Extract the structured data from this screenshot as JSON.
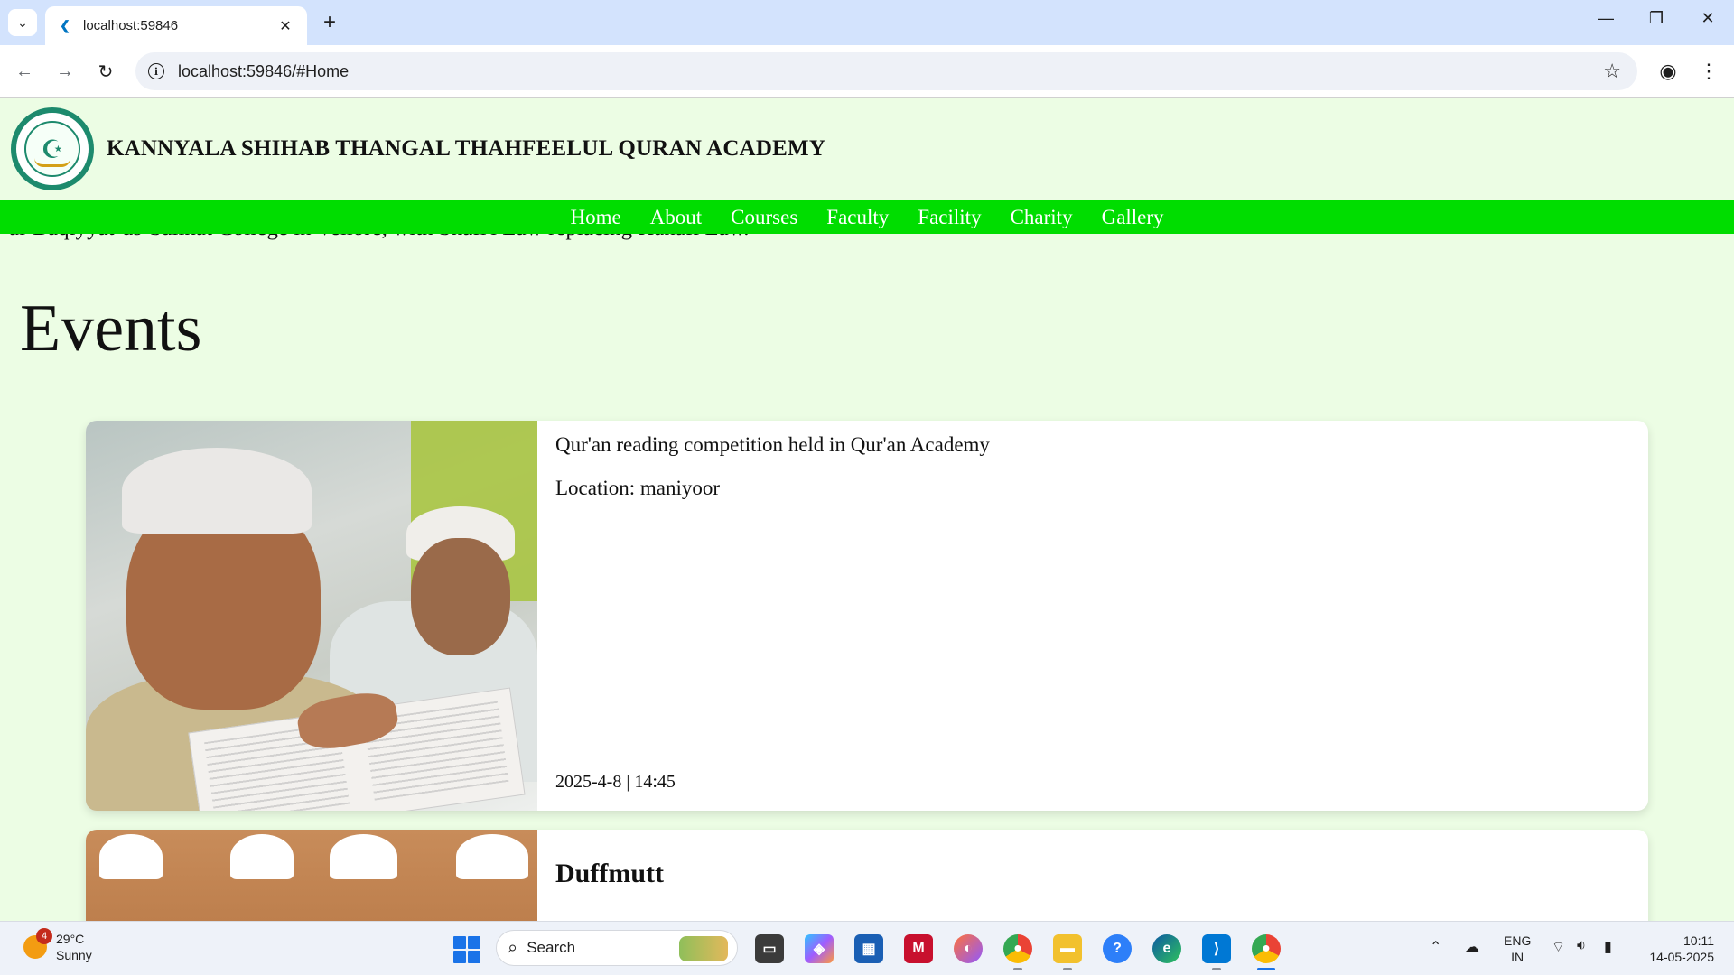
{
  "browser": {
    "tab_title": "localhost:59846",
    "url": "localhost:59846/#Home"
  },
  "site": {
    "title": "KANNYALA SHIHAB THANGAL THAHFEELUL QURAN ACADEMY",
    "nav": [
      "Home",
      "About",
      "Courses",
      "Faculty",
      "Facility",
      "Charity",
      "Gallery"
    ],
    "scrolled_text": "al-Baqiyyat-us-Salihat College in Vellore, with Shafi'i Law replacing Hanafi Law."
  },
  "events": {
    "heading": "Events",
    "items": [
      {
        "title": "Qur'an reading competition held in Qur'an Academy",
        "location": "Location: maniyoor",
        "datetime": "2025-4-8 | 14:45"
      },
      {
        "title": "Duffmutt"
      }
    ]
  },
  "taskbar": {
    "weather_temp": "29°C",
    "weather_desc": "Sunny",
    "weather_badge": "4",
    "search_label": "Search",
    "lang_line1": "ENG",
    "lang_line2": "IN",
    "time": "10:11",
    "date": "14-05-2025"
  },
  "colors": {
    "page_bg": "#ecfde4",
    "nav_bg": "#00dd00",
    "nav_text": "#ffffff",
    "tabstrip": "#d3e3fd"
  }
}
